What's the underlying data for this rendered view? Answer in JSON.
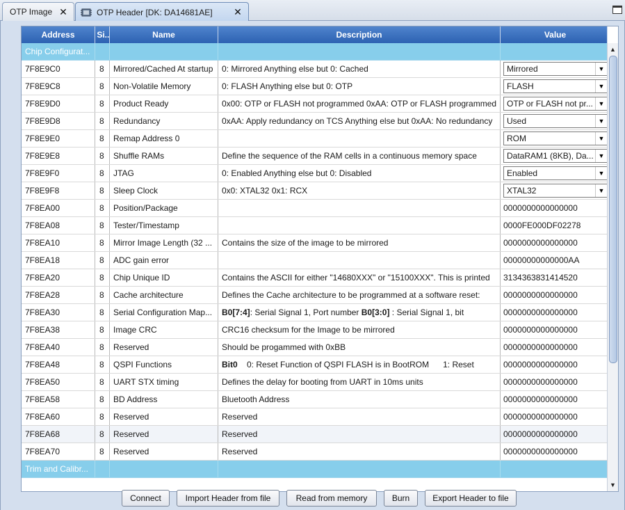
{
  "tabs": [
    {
      "label": "OTP Image",
      "active": false
    },
    {
      "label": "OTP Header [DK: DA14681AE]",
      "active": true
    }
  ],
  "table": {
    "columns": [
      "Address",
      "Si...",
      "Name",
      "Description",
      "Value"
    ],
    "groups": {
      "chip": "Chip Configurat...",
      "trim": "Trim and Calibr..."
    },
    "rows": [
      {
        "address": "7F8E9C0",
        "size": "8",
        "name": "Mirrored/Cached At startup",
        "desc": "0: Mirrored Anything else but 0: Cached",
        "value": "Mirrored",
        "combo": true
      },
      {
        "address": "7F8E9C8",
        "size": "8",
        "name": "Non-Volatile Memory",
        "desc": "0: FLASH Anything else but 0: OTP",
        "value": "FLASH",
        "combo": true
      },
      {
        "address": "7F8E9D0",
        "size": "8",
        "name": "Product Ready",
        "desc": "0x00: OTP or FLASH not programmed 0xAA: OTP or FLASH programmed",
        "value": "OTP or FLASH not pr...",
        "combo": true
      },
      {
        "address": "7F8E9D8",
        "size": "8",
        "name": "Redundancy",
        "desc": "0xAA: Apply redundancy on TCS Anything else but 0xAA: No redundancy",
        "value": "Used",
        "combo": true
      },
      {
        "address": "7F8E9E0",
        "size": "8",
        "name": "Remap Address 0",
        "desc": "",
        "value": "ROM",
        "combo": true
      },
      {
        "address": "7F8E9E8",
        "size": "8",
        "name": "Shuffle RAMs",
        "desc": "Define the sequence of the RAM cells in a continuous memory space",
        "value": "DataRAM1 (8KB), Da...",
        "combo": true
      },
      {
        "address": "7F8E9F0",
        "size": "8",
        "name": "JTAG",
        "desc": "0: Enabled Anything else but 0: Disabled",
        "value": "Enabled",
        "combo": true
      },
      {
        "address": "7F8E9F8",
        "size": "8",
        "name": "Sleep Clock",
        "desc": "0x0: XTAL32 0x1: RCX",
        "value": "XTAL32",
        "combo": true
      },
      {
        "address": "7F8EA00",
        "size": "8",
        "name": "Position/Package",
        "desc": "",
        "value": "0000000000000000",
        "combo": false
      },
      {
        "address": "7F8EA08",
        "size": "8",
        "name": "Tester/Timestamp",
        "desc": "",
        "value": "0000FE000DF02278",
        "combo": false
      },
      {
        "address": "7F8EA10",
        "size": "8",
        "name": "Mirror Image Length (32 ...",
        "desc": "Contains the size of the image to be mirrored",
        "value": "0000000000000000",
        "combo": false
      },
      {
        "address": "7F8EA18",
        "size": "8",
        "name": "ADC gain error",
        "desc": "",
        "value": "00000000000000AA",
        "combo": false
      },
      {
        "address": "7F8EA20",
        "size": "8",
        "name": "Chip Unique ID",
        "desc": "Contains the ASCII for either \"14680XXX\" or \"15100XXX\". This is printed",
        "value": "3134363831414520",
        "combo": false
      },
      {
        "address": "7F8EA28",
        "size": "8",
        "name": "Cache architecture",
        "desc": "Defines the Cache architecture to be programmed at a software reset:",
        "value": "0000000000000000",
        "combo": false
      },
      {
        "address": "7F8EA30",
        "size": "8",
        "name": "Serial Configuration Map...",
        "desc_parts": [
          {
            "t": "B0[7:4]",
            "b": true
          },
          {
            "t": ": Serial Signal 1, Port number ",
            "b": false
          },
          {
            "t": "B0[3:0]",
            "b": true
          },
          {
            "t": " : Serial Signal 1, bit",
            "b": false
          }
        ],
        "value": "0000000000000000",
        "combo": false
      },
      {
        "address": "7F8EA38",
        "size": "8",
        "name": "Image CRC",
        "desc": "CRC16 checksum for the Image to be mirrored",
        "value": "0000000000000000",
        "combo": false
      },
      {
        "address": "7F8EA40",
        "size": "8",
        "name": "Reserved",
        "desc": "Should be progammed with 0xBB",
        "value": "0000000000000000",
        "combo": false
      },
      {
        "address": "7F8EA48",
        "size": "8",
        "name": "QSPI Functions",
        "desc_parts": [
          {
            "t": "Bit0",
            "b": true
          },
          {
            "t": "    0: Reset Function of QSPI FLASH is in BootROM      1: Reset",
            "b": false
          }
        ],
        "value": "0000000000000000",
        "combo": false
      },
      {
        "address": "7F8EA50",
        "size": "8",
        "name": "UART STX timing",
        "desc": "Defines the delay for booting from UART in 10ms units",
        "value": "0000000000000000",
        "combo": false
      },
      {
        "address": "7F8EA58",
        "size": "8",
        "name": "BD Address",
        "desc": "Bluetooth Address",
        "value": "0000000000000000",
        "combo": false
      },
      {
        "address": "7F8EA60",
        "size": "8",
        "name": "Reserved",
        "desc": "Reserved",
        "value": "0000000000000000",
        "combo": false
      },
      {
        "address": "7F8EA68",
        "size": "8",
        "name": "Reserved",
        "desc": "Reserved",
        "value": "0000000000000000",
        "combo": false,
        "alt": true
      },
      {
        "address": "7F8EA70",
        "size": "8",
        "name": "Reserved",
        "desc": "Reserved",
        "value": "0000000000000000",
        "combo": false
      }
    ]
  },
  "buttons": {
    "connect": "Connect",
    "import": "Import Header from file",
    "read": "Read from memory",
    "burn": "Burn",
    "export": "Export Header to file"
  },
  "icons": {
    "tab_close": "close-icon",
    "maximize": "maximize-icon",
    "combo_arrow": "chevron-down-icon",
    "scroll_up": "scroll-up-icon",
    "scroll_down": "scroll-down-icon"
  },
  "colors": {
    "header_bg": "#2d62b2",
    "group_bg": "#87ceeb",
    "panel_bg": "#d4dfee"
  }
}
